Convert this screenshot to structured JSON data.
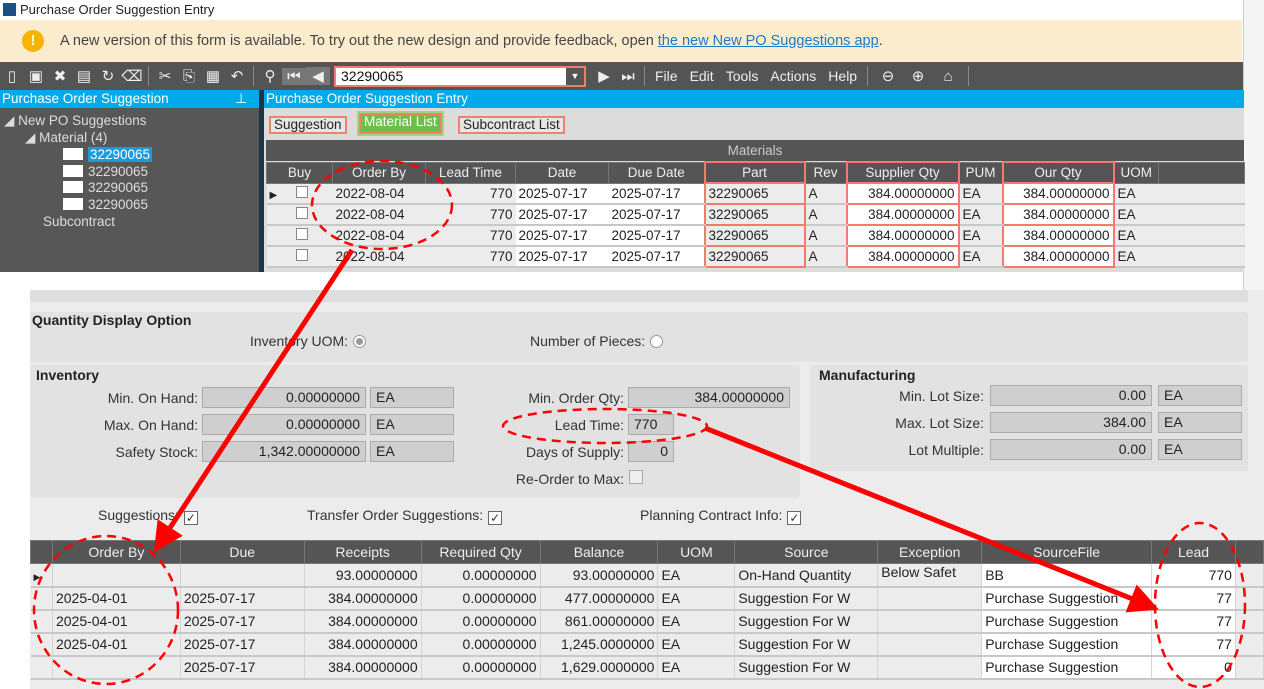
{
  "window": {
    "title": "Purchase Order Suggestion Entry"
  },
  "banner": {
    "text": "A new version of this form is available. To try out the new design and provide feedback, open",
    "link": "the new New PO Suggestions app",
    "end": "."
  },
  "toolbar": {
    "search_value": "32290065",
    "menus": [
      "File",
      "Edit",
      "Tools",
      "Actions",
      "Help"
    ]
  },
  "left_panel": {
    "title": "Purchase Order Suggestion",
    "tree": {
      "root": "New PO Suggestions",
      "material": "Material (4)",
      "items": [
        "32290065",
        "32290065",
        "32290065",
        "32290065"
      ],
      "subcontract": "Subcontract"
    }
  },
  "main": {
    "title": "Purchase Order Suggestion Entry",
    "tabs": [
      "Suggestion",
      "Material List",
      "Subcontract List"
    ],
    "active_tab": "Material List",
    "group_header": "Materials",
    "columns": [
      "Buy",
      "Order By",
      "Lead Time",
      "Date",
      "Due Date",
      "Part",
      "Rev",
      "Supplier Qty",
      "PUM",
      "Our Qty",
      "UOM"
    ],
    "rows": [
      [
        "2022-08-04",
        "770",
        "2025-07-17",
        "2025-07-17",
        "32290065",
        "A",
        "384.00000000",
        "EA",
        "384.00000000",
        "EA"
      ],
      [
        "2022-08-04",
        "770",
        "2025-07-17",
        "2025-07-17",
        "32290065",
        "A",
        "384.00000000",
        "EA",
        "384.00000000",
        "EA"
      ],
      [
        "2022-08-04",
        "770",
        "2025-07-17",
        "2025-07-17",
        "32290065",
        "A",
        "384.00000000",
        "EA",
        "384.00000000",
        "EA"
      ],
      [
        "2022-08-04",
        "770",
        "2025-07-17",
        "2025-07-17",
        "32290065",
        "A",
        "384.00000000",
        "EA",
        "384.00000000",
        "EA"
      ]
    ]
  },
  "qty_display": {
    "title": "Quantity Display Option",
    "inventory_uom": "Inventory UOM:",
    "number_of_pieces": "Number of Pieces:"
  },
  "inventory": {
    "title": "Inventory",
    "min_on_hand_label": "Min. On Hand:",
    "min_on_hand": "0.00000000",
    "max_on_hand_label": "Max. On Hand:",
    "max_on_hand": "0.00000000",
    "safety_stock_label": "Safety Stock:",
    "safety_stock": "1,342.00000000",
    "uom": "EA",
    "min_order_qty_label": "Min. Order Qty:",
    "min_order_qty": "384.00000000",
    "lead_time_label": "Lead Time:",
    "lead_time": "770",
    "days_of_supply_label": "Days of Supply:",
    "days_of_supply": "0",
    "reorder_label": "Re-Order to Max:"
  },
  "manufacturing": {
    "title": "Manufacturing",
    "min_lot_label": "Min. Lot Size:",
    "min_lot": "0.00",
    "max_lot_label": "Max. Lot Size:",
    "max_lot": "384.00",
    "lot_multiple_label": "Lot Multiple:",
    "lot_multiple": "0.00",
    "uom": "EA"
  },
  "options": {
    "suggestions": "Suggestions:",
    "transfer": "Transfer Order Suggestions:",
    "planning": "Planning Contract Info:"
  },
  "detail": {
    "columns": [
      "Order By",
      "Due",
      "Receipts",
      "Required Qty",
      "Balance",
      "UOM",
      "Source",
      "Exception",
      "SourceFile",
      "Lead"
    ],
    "rows": [
      [
        "",
        "",
        "93.00000000",
        "0.00000000",
        "93.00000000",
        "EA",
        "On-Hand Quantity",
        "Below Safet",
        "BB",
        "770"
      ],
      [
        "2025-04-01",
        "2025-07-17",
        "384.00000000",
        "0.00000000",
        "477.00000000",
        "EA",
        "Suggestion For W",
        "",
        "Purchase Suggestion",
        "77"
      ],
      [
        "2025-04-01",
        "2025-07-17",
        "384.00000000",
        "0.00000000",
        "861.00000000",
        "EA",
        "Suggestion For W",
        "",
        "Purchase Suggestion",
        "77"
      ],
      [
        "2025-04-01",
        "2025-07-17",
        "384.00000000",
        "0.00000000",
        "1,245.0000000",
        "EA",
        "Suggestion For W",
        "",
        "Purchase Suggestion",
        "77"
      ],
      [
        "",
        "2025-07-17",
        "384.00000000",
        "0.00000000",
        "1,629.0000000",
        "EA",
        "Suggestion For W",
        "",
        "Purchase Suggestion",
        "0"
      ]
    ]
  },
  "colors": {
    "accent_blue": "#00aaeb",
    "annotation_red": "#ff0000",
    "highlight_border": "#f07c6c",
    "active_tab": "#6cc04a"
  }
}
